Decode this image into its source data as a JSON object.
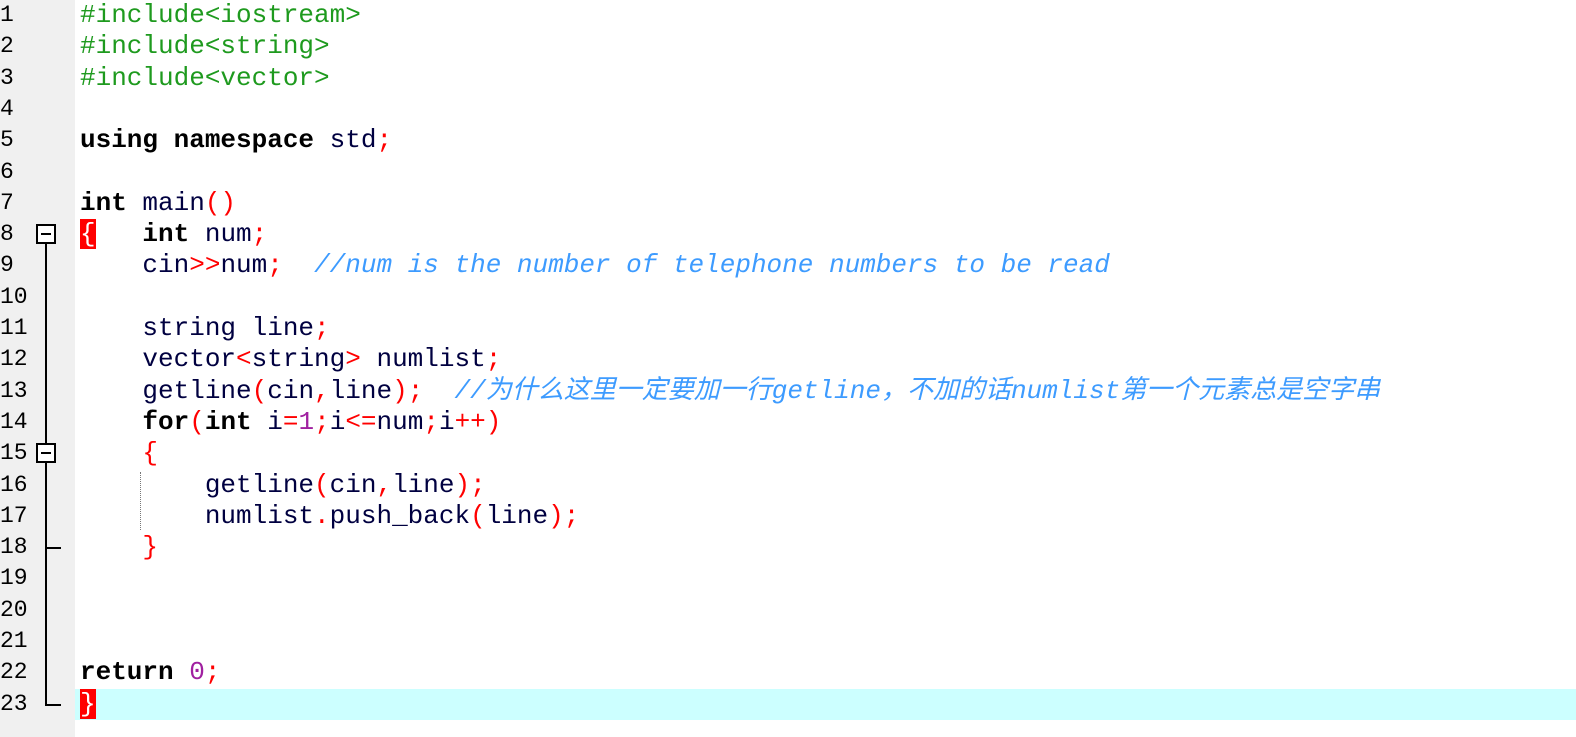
{
  "editor": {
    "current_line": 23,
    "line_numbers": [
      "1",
      "2",
      "3",
      "4",
      "5",
      "6",
      "7",
      "8",
      "9",
      "10",
      "11",
      "12",
      "13",
      "14",
      "15",
      "16",
      "17",
      "18",
      "19",
      "20",
      "21",
      "22",
      "23"
    ],
    "lines": [
      [
        {
          "t": "pp",
          "s": "#include<iostream>"
        }
      ],
      [
        {
          "t": "pp",
          "s": "#include<string>"
        }
      ],
      [
        {
          "t": "pp",
          "s": "#include<vector>"
        }
      ],
      [],
      [
        {
          "t": "kw",
          "s": "using namespace"
        },
        {
          "t": "id",
          "s": " std"
        },
        {
          "t": "op",
          "s": ";"
        }
      ],
      [],
      [
        {
          "t": "kw",
          "s": "int"
        },
        {
          "t": "id",
          "s": " main"
        },
        {
          "t": "op",
          "s": "()"
        }
      ],
      [
        {
          "t": "brm",
          "s": "{"
        },
        {
          "t": "id",
          "s": "   "
        },
        {
          "t": "kw",
          "s": "int"
        },
        {
          "t": "id",
          "s": " num"
        },
        {
          "t": "op",
          "s": ";"
        }
      ],
      [
        {
          "t": "id",
          "s": "    cin"
        },
        {
          "t": "op",
          "s": ">>"
        },
        {
          "t": "id",
          "s": "num"
        },
        {
          "t": "op",
          "s": ";"
        },
        {
          "t": "id",
          "s": "  "
        },
        {
          "t": "cm",
          "s": "//num is the number of telephone numbers to be read"
        }
      ],
      [],
      [
        {
          "t": "id",
          "s": "    string line"
        },
        {
          "t": "op",
          "s": ";"
        }
      ],
      [
        {
          "t": "id",
          "s": "    vector"
        },
        {
          "t": "op",
          "s": "<"
        },
        {
          "t": "id",
          "s": "string"
        },
        {
          "t": "op",
          "s": ">"
        },
        {
          "t": "id",
          "s": " numlist"
        },
        {
          "t": "op",
          "s": ";"
        }
      ],
      [
        {
          "t": "id",
          "s": "    getline"
        },
        {
          "t": "op",
          "s": "("
        },
        {
          "t": "id",
          "s": "cin"
        },
        {
          "t": "op",
          "s": ","
        },
        {
          "t": "id",
          "s": "line"
        },
        {
          "t": "op",
          "s": ");"
        },
        {
          "t": "id",
          "s": "  "
        },
        {
          "t": "cm",
          "s": "//为什么这里一定要加一行getline，不加的话numlist第一个元素总是空字串"
        }
      ],
      [
        {
          "t": "id",
          "s": "    "
        },
        {
          "t": "kw",
          "s": "for"
        },
        {
          "t": "op",
          "s": "("
        },
        {
          "t": "kw",
          "s": "int"
        },
        {
          "t": "id",
          "s": " i"
        },
        {
          "t": "op",
          "s": "="
        },
        {
          "t": "num",
          "s": "1"
        },
        {
          "t": "op",
          "s": ";"
        },
        {
          "t": "id",
          "s": "i"
        },
        {
          "t": "op",
          "s": "<="
        },
        {
          "t": "id",
          "s": "num"
        },
        {
          "t": "op",
          "s": ";"
        },
        {
          "t": "id",
          "s": "i"
        },
        {
          "t": "op",
          "s": "++)"
        }
      ],
      [
        {
          "t": "id",
          "s": "    "
        },
        {
          "t": "op",
          "s": "{"
        }
      ],
      [
        {
          "t": "id",
          "s": "        getline"
        },
        {
          "t": "op",
          "s": "("
        },
        {
          "t": "id",
          "s": "cin"
        },
        {
          "t": "op",
          "s": ","
        },
        {
          "t": "id",
          "s": "line"
        },
        {
          "t": "op",
          "s": ");"
        }
      ],
      [
        {
          "t": "id",
          "s": "        numlist"
        },
        {
          "t": "op",
          "s": "."
        },
        {
          "t": "id",
          "s": "push_back"
        },
        {
          "t": "op",
          "s": "("
        },
        {
          "t": "id",
          "s": "line"
        },
        {
          "t": "op",
          "s": ");"
        }
      ],
      [
        {
          "t": "id",
          "s": "    "
        },
        {
          "t": "op",
          "s": "}"
        }
      ],
      [],
      [],
      [],
      [
        {
          "t": "kw",
          "s": "return"
        },
        {
          "t": "id",
          "s": " "
        },
        {
          "t": "num",
          "s": "0"
        },
        {
          "t": "op",
          "s": ";"
        }
      ],
      [
        {
          "t": "brm",
          "s": "}"
        }
      ]
    ],
    "colors": {
      "preprocessor": "#1e9a1e",
      "keyword": "#000000",
      "operator": "#ff0000",
      "number": "#a020a0",
      "comment": "#3d9bff",
      "current_line": "#ccffff"
    }
  }
}
